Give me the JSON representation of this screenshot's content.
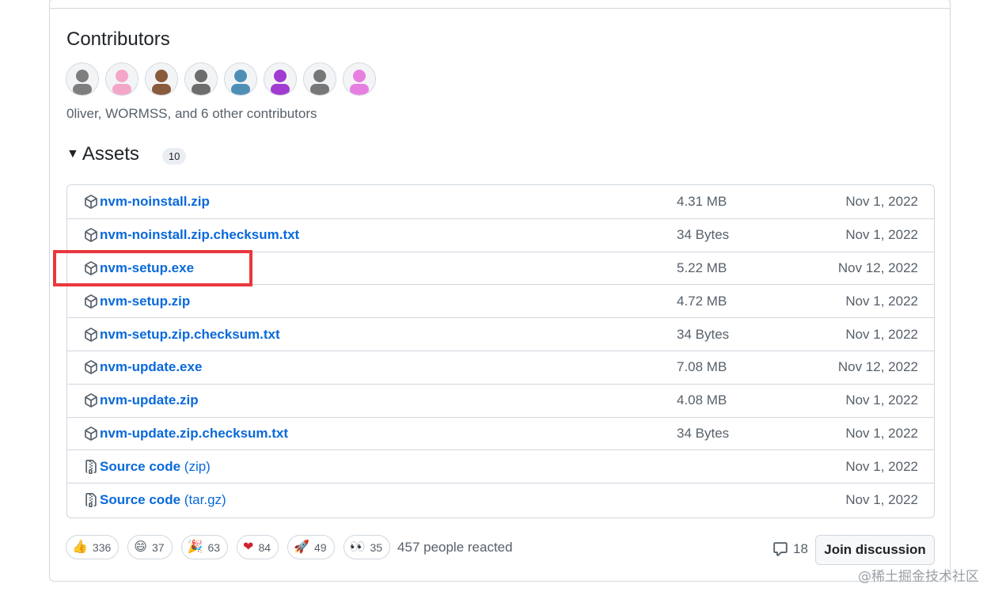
{
  "contributors": {
    "title": "Contributors",
    "summary": "0liver, WORMSS, and 6 other contributors",
    "avatar_colors": [
      "#7e7e7e",
      "#f4a6c8",
      "#8a5a3c",
      "#6d6d6d",
      "#4f8fb6",
      "#a13bd1",
      "#777777",
      "#e77fe0"
    ]
  },
  "assets": {
    "title": "Assets",
    "count": "10",
    "rows": [
      {
        "name": "nvm-noinstall.zip",
        "sub": "",
        "size": "4.31 MB",
        "date": "Nov 1, 2022",
        "icon": "package-icon"
      },
      {
        "name": "nvm-noinstall.zip.checksum.txt",
        "sub": "",
        "size": "34 Bytes",
        "date": "Nov 1, 2022",
        "icon": "package-icon"
      },
      {
        "name": "nvm-setup.exe",
        "sub": "",
        "size": "5.22 MB",
        "date": "Nov 12, 2022",
        "icon": "package-icon"
      },
      {
        "name": "nvm-setup.zip",
        "sub": "",
        "size": "4.72 MB",
        "date": "Nov 1, 2022",
        "icon": "package-icon"
      },
      {
        "name": "nvm-setup.zip.checksum.txt",
        "sub": "",
        "size": "34 Bytes",
        "date": "Nov 1, 2022",
        "icon": "package-icon"
      },
      {
        "name": "nvm-update.exe",
        "sub": "",
        "size": "7.08 MB",
        "date": "Nov 12, 2022",
        "icon": "package-icon"
      },
      {
        "name": "nvm-update.zip",
        "sub": "",
        "size": "4.08 MB",
        "date": "Nov 1, 2022",
        "icon": "package-icon"
      },
      {
        "name": "nvm-update.zip.checksum.txt",
        "sub": "",
        "size": "34 Bytes",
        "date": "Nov 1, 2022",
        "icon": "package-icon"
      },
      {
        "name": "Source code",
        "sub": "(zip)",
        "size": "",
        "date": "Nov 1, 2022",
        "icon": "file-zip-icon"
      },
      {
        "name": "Source code",
        "sub": "(tar.gz)",
        "size": "",
        "date": "Nov 1, 2022",
        "icon": "file-zip-icon"
      }
    ]
  },
  "reactions": {
    "items": [
      {
        "emoji": "👍",
        "count": "336",
        "icon": "thumbs-up-icon"
      },
      {
        "emoji": "😄",
        "count": "37",
        "icon": "laugh-icon"
      },
      {
        "emoji": "🎉",
        "count": "63",
        "icon": "hooray-icon"
      },
      {
        "emoji": "❤",
        "count": "84",
        "icon": "heart-icon"
      },
      {
        "emoji": "🚀",
        "count": "49",
        "icon": "rocket-icon"
      },
      {
        "emoji": "👀",
        "count": "35",
        "icon": "eyes-icon"
      }
    ],
    "summary": "457 people reacted"
  },
  "discussion": {
    "comment_count": "18",
    "join_label": "Join discussion"
  },
  "watermark": "@稀土掘金技术社区",
  "highlight_color": "#e8383d",
  "link_color": "#0969da"
}
